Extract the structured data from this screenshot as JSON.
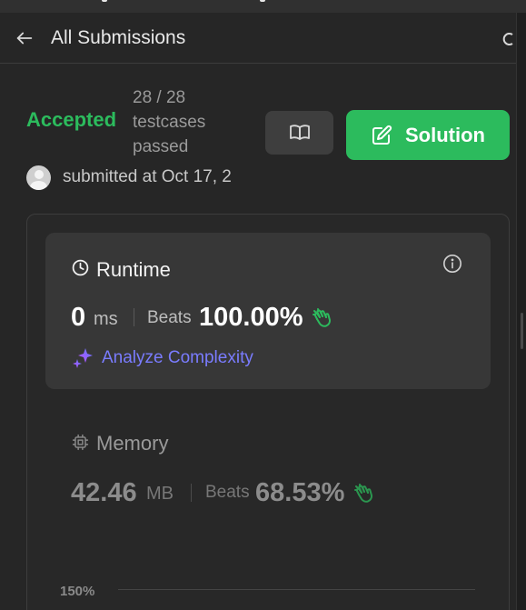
{
  "header": {
    "title": "All Submissions"
  },
  "submission": {
    "status": "Accepted",
    "testcases": "28 / 28",
    "testcases_label": "testcases",
    "passed_label": "passed",
    "solution_button": "Solution",
    "submitted_text": "submitted at Oct 17, 2"
  },
  "runtime": {
    "label": "Runtime",
    "value": "0",
    "unit": "ms",
    "beats_label": "Beats",
    "beats": "100.00%",
    "analyze": "Analyze Complexity"
  },
  "memory": {
    "label": "Memory",
    "value": "42.46",
    "unit": "MB",
    "beats_label": "Beats",
    "beats": "68.53%"
  },
  "chart": {
    "y_tick_top": "150%"
  },
  "colors": {
    "accent_green": "#2cbb5d",
    "analyze_purple": "#7a7cff"
  }
}
